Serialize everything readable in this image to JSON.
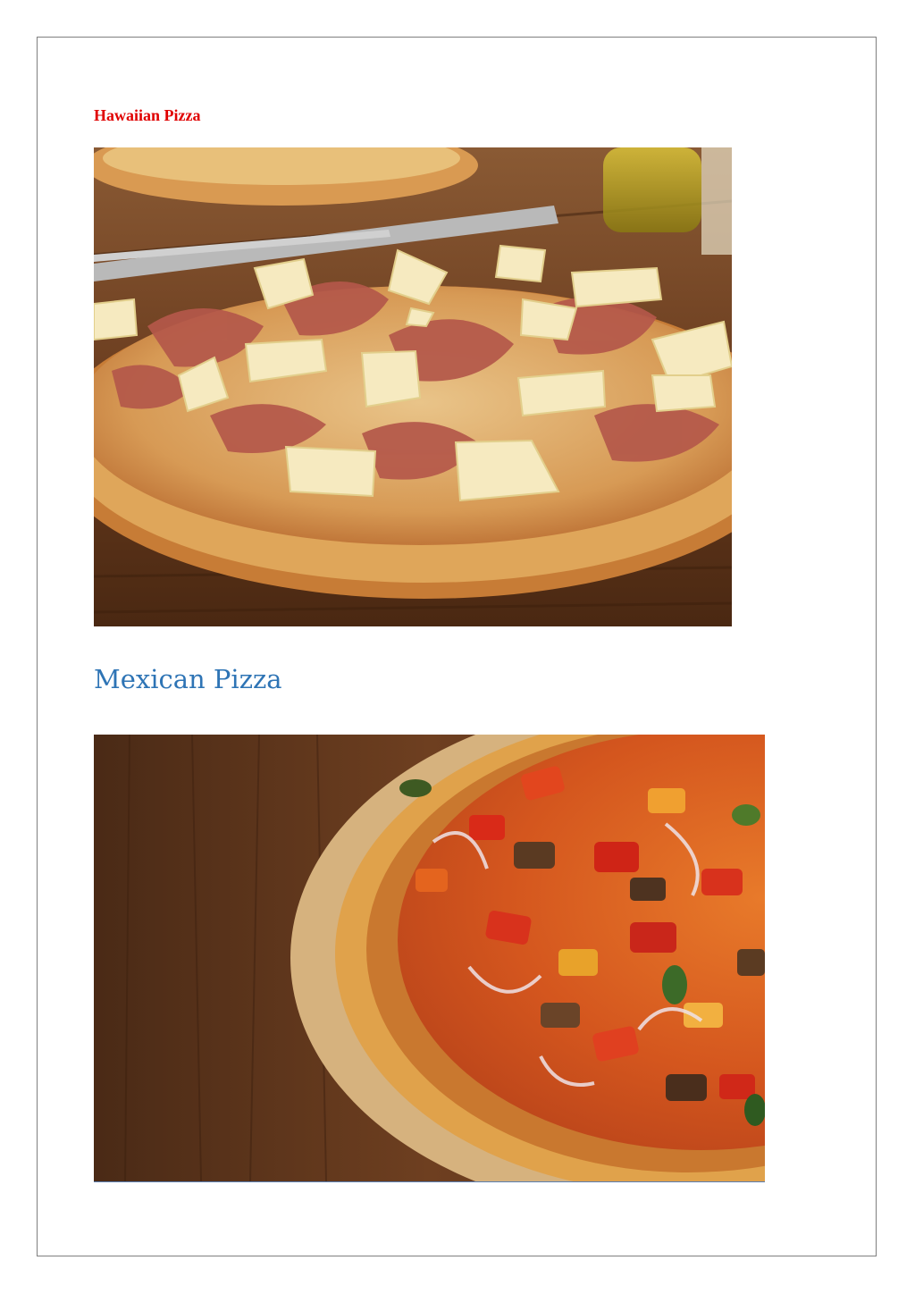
{
  "document": {
    "sections": [
      {
        "title": "Hawaiian Pizza",
        "title_color": "#e00000",
        "image": {
          "name": "hawaiian-pizza-photo",
          "subject": "ham and pineapple pizza on wooden table with fork and olive oil"
        }
      },
      {
        "title": "Mexican Pizza",
        "title_color": "#2e74b5",
        "image": {
          "name": "mexican-pizza-photo",
          "subject": "vegetable pizza pie with peppers, eggplant and onion in pastry crust on wooden table"
        }
      }
    ]
  },
  "colors": {
    "page_border": "#7f7f7f",
    "wood_dark": "#5a3219",
    "crust": "#d9a04c",
    "pineapple": "#f4e7b5",
    "ham": "#b45a4a",
    "red_pepper": "#d8321c"
  }
}
